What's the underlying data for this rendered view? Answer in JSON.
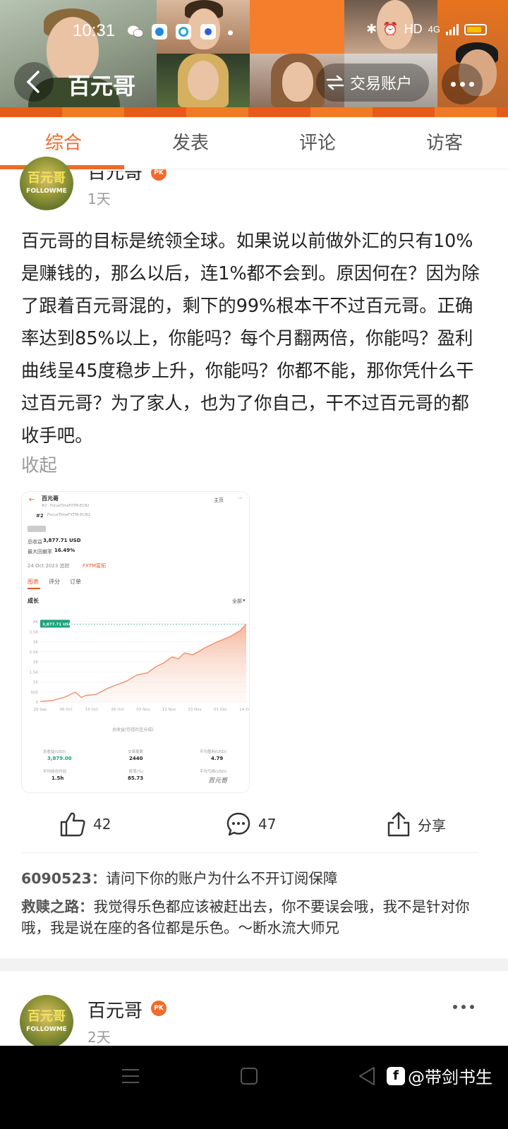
{
  "status_bar": {
    "time": "10:31",
    "network": "HD",
    "signal": "4G"
  },
  "nav": {
    "title": "百元哥",
    "trade_button": "交易账户"
  },
  "tabs": [
    {
      "label": "综合",
      "active": true
    },
    {
      "label": "发表",
      "active": false
    },
    {
      "label": "评论",
      "active": false
    },
    {
      "label": "访客",
      "active": false
    }
  ],
  "post": {
    "author": "百元哥",
    "badge": "PK",
    "time": "1天",
    "avatar_text": [
      "百元哥",
      "FOLLOWME"
    ],
    "text": "百元哥的目标是统领全球。如果说以前做外汇的只有10%是赚钱的，那么以后，连1%都不会到。原因何在？因为除了跟着百元哥混的，剩下的99%根本干不过百元哥。正确率达到85%以上，你能吗？每个月翻两倍，你能吗？盈利曲线呈45度稳步上升，你能吗？你都不能，那你凭什么干过百元哥？为了家人，也为了你自己，干不过百元哥的都收手吧。",
    "collapse": "收起",
    "likes": "42",
    "comments": "47",
    "share": "分享"
  },
  "embedded": {
    "title": "百元哥",
    "subtitle": "#2 · FocusTimeFXTM-ECN2",
    "home": "主页",
    "rank": "#2",
    "account": "FocusTimeFXTM-ECN2",
    "total_label": "总收益",
    "total_value": "3,877.71 USD",
    "drawdown_label": "最大回撤率",
    "drawdown_value": "16.49%",
    "date": "24 Oct 2023 追踪",
    "broker": "FXTM富拓",
    "tabs": [
      "图表",
      "评分",
      "订单"
    ],
    "section": "成长",
    "range": "全部",
    "tooltip": "3,877.71 USD",
    "legend": "总收益(包括社区分成)",
    "stats": [
      {
        "label": "总收益(USD)",
        "value": "3,879.00"
      },
      {
        "label": "交易笔数",
        "value": "2440"
      },
      {
        "label": "平均盈利(USD)",
        "value": "4.79"
      },
      {
        "label": "平均持仓时间",
        "value": "1.5h"
      },
      {
        "label": "胜率(%)",
        "value": "85.73"
      },
      {
        "label": "平均亏损(USD)",
        "value": ""
      }
    ],
    "watermark": "百元哥"
  },
  "chart_data": {
    "type": "area",
    "title": "成长",
    "x_ticks": [
      "28 Sep",
      "06 Oct",
      "16 Oct",
      "26 Oct",
      "03 Nov",
      "12 Nov",
      "23 Nov",
      "03 Dec",
      "14 Dec"
    ],
    "y_ticks": [
      "0",
      "500",
      "1K",
      "1.5K",
      "2K",
      "2.5K",
      "3K",
      "3.5K",
      "4K"
    ],
    "ylim": [
      0,
      4000
    ],
    "series": [
      {
        "name": "总收益(包括社区分成)",
        "x": [
          0,
          0.06,
          0.12,
          0.17,
          0.2,
          0.22,
          0.27,
          0.32,
          0.36,
          0.42,
          0.47,
          0.52,
          0.56,
          0.6,
          0.64,
          0.67,
          0.7,
          0.74,
          0.8,
          0.86,
          0.92,
          0.97,
          1.0
        ],
        "values": [
          30,
          80,
          250,
          500,
          230,
          330,
          380,
          650,
          820,
          1050,
          1350,
          1450,
          1750,
          1950,
          2250,
          2150,
          2450,
          2350,
          2700,
          3000,
          3250,
          3550,
          3880
        ]
      }
    ],
    "legend": "bottom"
  },
  "comments": [
    {
      "name": "6090523：",
      "text": "请问下你的账户为什么不开订阅保障"
    },
    {
      "name": "救赎之路：",
      "text": "我觉得乐色都应该被赶出去，你不要误会哦，我不是针对你哦，我是说在座的各位都是乐色。～断水流大师兄"
    }
  ],
  "post2": {
    "author": "百元哥",
    "badge": "PK",
    "time": "2天",
    "avatar_text": [
      "百元哥",
      "FOLLOWME"
    ]
  },
  "watermark": {
    "logo": "f",
    "text": "@带剑书生"
  },
  "colors": {
    "accent": "#f06a2a",
    "chart_line": "#f08a6a",
    "tooltip_bg": "#1aa37a"
  }
}
